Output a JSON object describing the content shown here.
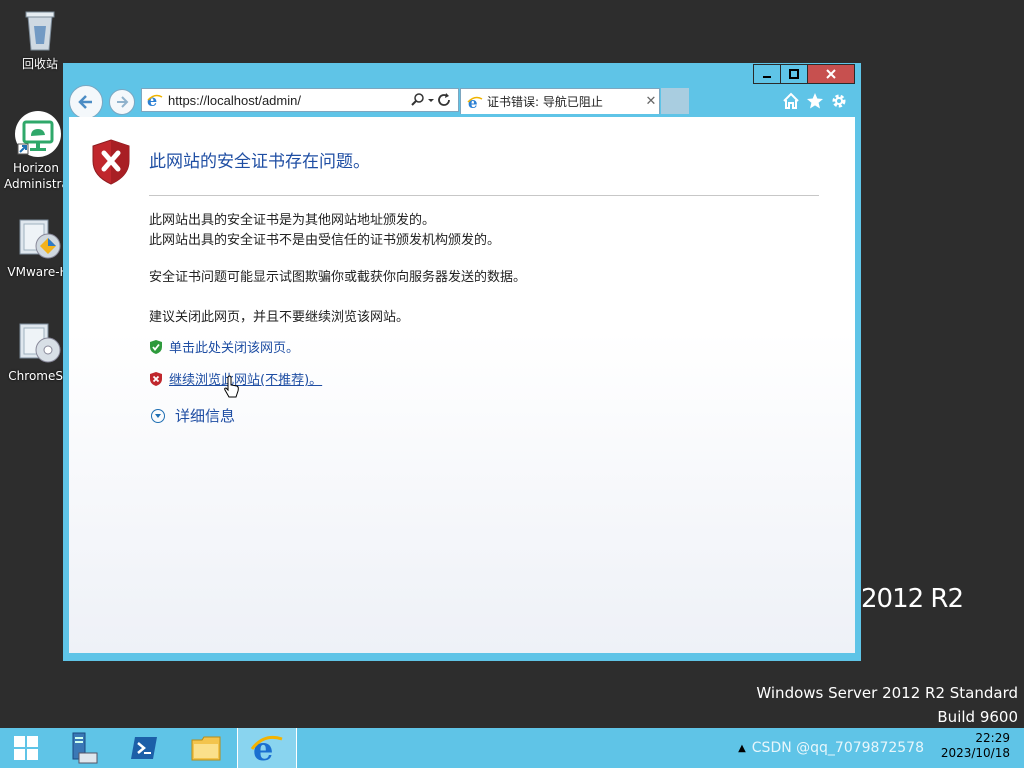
{
  "desktop": {
    "icons": [
      {
        "label": "回收站"
      },
      {
        "label": "Horizon Administra"
      },
      {
        "label": "VMware-H"
      },
      {
        "label": "ChromeSt"
      }
    ],
    "watermark": {
      "os_name": "Windows Server 2012 R2 Standard",
      "build": "Build 9600",
      "edition_partial": "2012 R2"
    }
  },
  "browser": {
    "address": "https://localhost/admin/",
    "tab_title": "证书错误: 导航已阻止",
    "window_buttons": {
      "minimize": "–",
      "maximize": "□",
      "close": "✕"
    }
  },
  "page": {
    "heading": "此网站的安全证书存在问题。",
    "line1": "此网站出具的安全证书是为其他网站地址颁发的。",
    "line2": "此网站出具的安全证书不是由受信任的证书颁发机构颁发的。",
    "line3": "安全证书问题可能显示试图欺骗你或截获你向服务器发送的数据。",
    "line4": "建议关闭此网页，并且不要继续浏览该网站。",
    "close_link": "单击此处关闭该网页。",
    "continue_link": "继续浏览此网站(不推荐)。",
    "details": "详细信息"
  },
  "taskbar": {
    "time": "22:29",
    "date": "2023/10/18",
    "tray_overlay": "CSDN @qq_7079872578"
  },
  "colors": {
    "accent": "#5fc4e7",
    "link": "#1f4ea3",
    "close_red": "#c7504f"
  }
}
